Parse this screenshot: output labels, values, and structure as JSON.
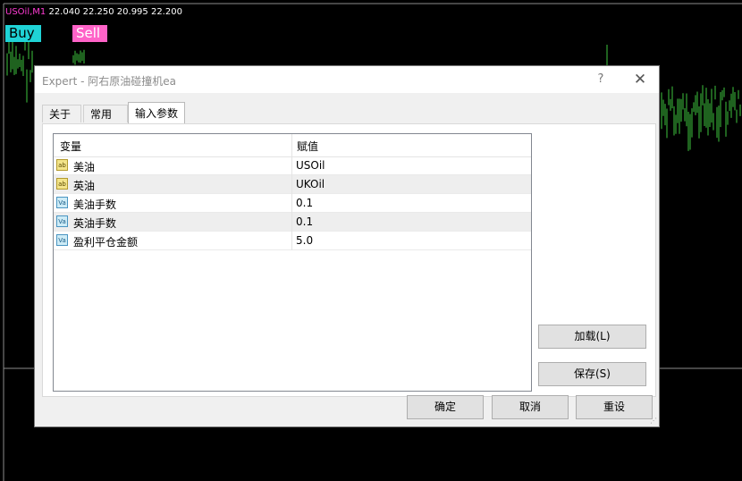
{
  "chart": {
    "symbol": "USOil,M1",
    "quote": "22.040 22.250 20.995 22.200",
    "buy_label": "Buy",
    "sell_label": "Sell",
    "candle_color": "#3ec43e",
    "line_color": "#8c8c8c"
  },
  "dialog": {
    "title": "Expert - 阿右原油碰撞机ea",
    "help_glyph": "?",
    "close_glyph": "✕",
    "tabs": [
      {
        "label": "关于",
        "active": false
      },
      {
        "label": "常用",
        "active": false
      },
      {
        "label": "输入参数",
        "active": true
      }
    ],
    "grid": {
      "col_variable": "变量",
      "col_value": "赋值",
      "rows": [
        {
          "icon": "ab",
          "type": "string-param-icon",
          "name": "美油",
          "value": "USOil"
        },
        {
          "icon": "ab",
          "type": "string-param-icon",
          "name": "英油",
          "value": "UKOil"
        },
        {
          "icon": "Va",
          "type": "numeric-param-icon",
          "name": "美油手数",
          "value": "0.1"
        },
        {
          "icon": "Va",
          "type": "numeric-param-icon",
          "name": "英油手数",
          "value": "0.1"
        },
        {
          "icon": "Va",
          "type": "numeric-param-icon",
          "name": "盈利平仓金额",
          "value": "5.0"
        }
      ]
    },
    "load_button": "加载(L)",
    "save_button": "保存(S)",
    "ok_button": "确定",
    "cancel_button": "取消",
    "reset_button": "重设"
  }
}
